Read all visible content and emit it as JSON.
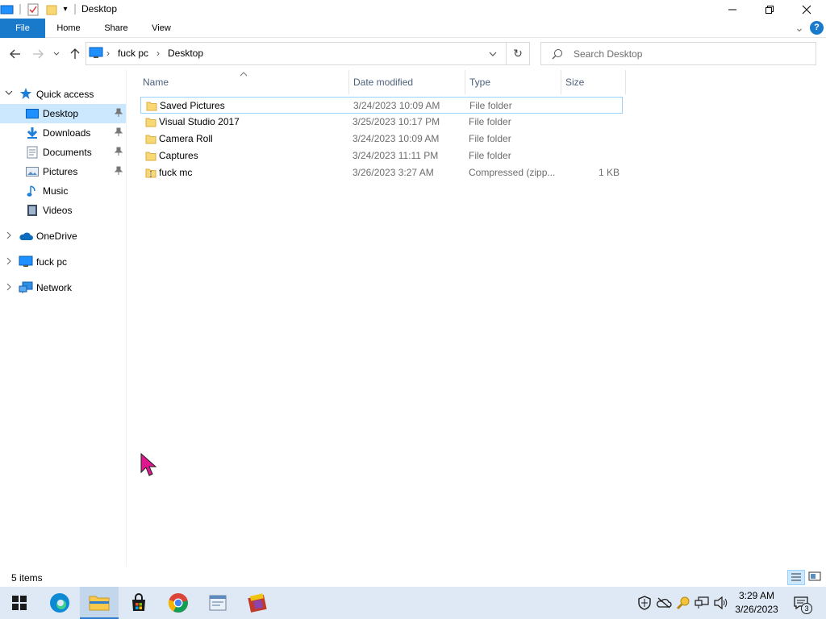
{
  "window": {
    "title": "Desktop",
    "minimize_glyph": "—",
    "restore_glyph": "❐",
    "close_glyph": "✕"
  },
  "ribbon": {
    "tabs": [
      {
        "label": "File"
      },
      {
        "label": "Home"
      },
      {
        "label": "Share"
      },
      {
        "label": "View"
      }
    ],
    "expand_glyph": "⌄",
    "help_glyph": "?"
  },
  "address": {
    "segments": [
      "fuck pc",
      "Desktop"
    ],
    "separator": "›",
    "dropdown_glyph": "⌄",
    "refresh_glyph": "↻"
  },
  "search": {
    "placeholder": "Search Desktop"
  },
  "navpane": {
    "quick_access": "Quick access",
    "items": [
      {
        "label": "Desktop",
        "icon": "desktop-icon",
        "pinned": true,
        "selected": true
      },
      {
        "label": "Downloads",
        "icon": "downloads-icon",
        "pinned": true
      },
      {
        "label": "Documents",
        "icon": "documents-icon",
        "pinned": true
      },
      {
        "label": "Pictures",
        "icon": "pictures-icon",
        "pinned": true
      },
      {
        "label": "Music",
        "icon": "music-icon",
        "pinned": false
      },
      {
        "label": "Videos",
        "icon": "videos-icon",
        "pinned": false
      }
    ],
    "roots": [
      {
        "label": "OneDrive",
        "icon": "onedrive-icon"
      },
      {
        "label": "fuck pc",
        "icon": "this-pc-icon"
      },
      {
        "label": "Network",
        "icon": "network-icon"
      }
    ],
    "pin_glyph": "📌"
  },
  "columns": {
    "name": "Name",
    "date": "Date modified",
    "type": "Type",
    "size": "Size"
  },
  "files": [
    {
      "name": "Saved Pictures",
      "date": "3/24/2023 10:09 AM",
      "type": "File folder",
      "size": "",
      "kind": "folder"
    },
    {
      "name": "Visual Studio 2017",
      "date": "3/25/2023 10:17 PM",
      "type": "File folder",
      "size": "",
      "kind": "folder"
    },
    {
      "name": "Camera Roll",
      "date": "3/24/2023 10:09 AM",
      "type": "File folder",
      "size": "",
      "kind": "folder"
    },
    {
      "name": "Captures",
      "date": "3/24/2023 11:11 PM",
      "type": "File folder",
      "size": "",
      "kind": "folder"
    },
    {
      "name": "fuck mc",
      "date": "3/26/2023 3:27 AM",
      "type": "Compressed (zipp...",
      "size": "1 KB",
      "kind": "zip"
    }
  ],
  "status": {
    "item_count": "5 items"
  },
  "taskbar": {
    "apps": [
      "start-icon",
      "edge-icon",
      "file-explorer-icon",
      "store-icon",
      "chrome-icon",
      "app-window-icon",
      "winrar-icon"
    ],
    "time": "3:29 AM",
    "date": "3/26/2023",
    "notification_count": "3"
  },
  "colors": {
    "accent": "#1979ca",
    "selection": "#cce8ff",
    "folder": "#f8d775",
    "taskbar": "#dfe9f5"
  }
}
